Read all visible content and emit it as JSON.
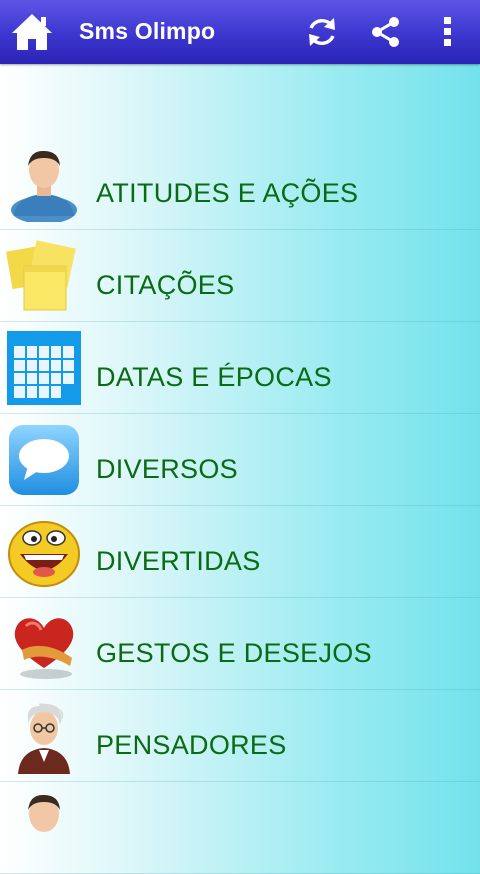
{
  "appbar": {
    "title": "Sms Olimpo",
    "icons": [
      "home-icon",
      "refresh-icon",
      "share-icon",
      "overflow-menu-icon"
    ]
  },
  "categories": [
    {
      "label": "ATITUDES E AÇÕES",
      "icon": "person-avatar-icon"
    },
    {
      "label": "CITAÇÕES",
      "icon": "sticky-notes-icon"
    },
    {
      "label": "DATAS E ÉPOCAS",
      "icon": "calendar-icon"
    },
    {
      "label": "DIVERSOS",
      "icon": "speech-bubble-icon"
    },
    {
      "label": "DIVERTIDAS",
      "icon": "laughing-face-icon"
    },
    {
      "label": "GESTOS E DESEJOS",
      "icon": "heart-icon"
    },
    {
      "label": "PENSADORES",
      "icon": "thinker-icon"
    },
    {
      "label": "",
      "icon": "person-avatar-icon"
    }
  ],
  "colors": {
    "appbar": "#3d36cf",
    "label_text": "#0b6a14",
    "background_end": "#73e2ec"
  }
}
